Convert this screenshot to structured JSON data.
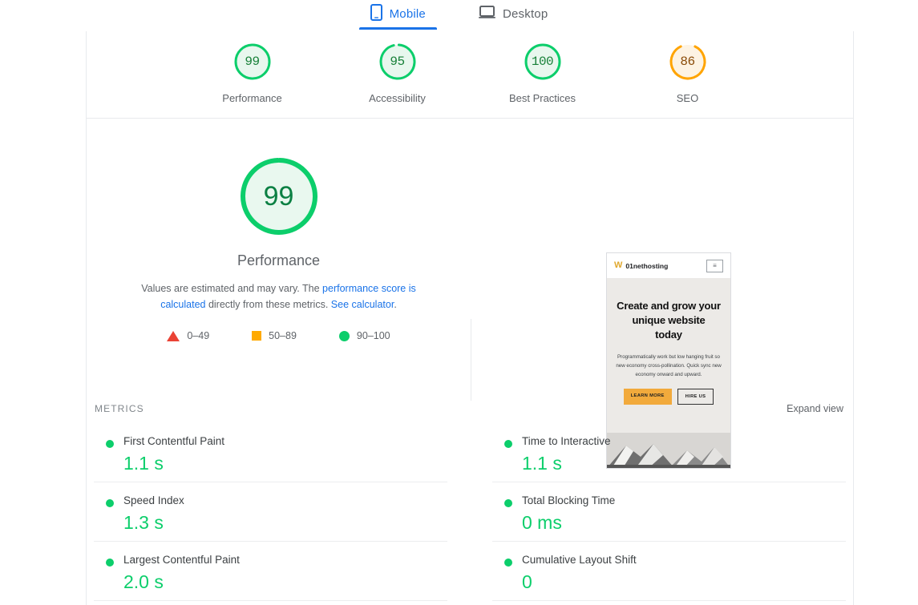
{
  "tabs": [
    {
      "label": "Mobile",
      "icon": "mobile-phone-icon",
      "active": true
    },
    {
      "label": "Desktop",
      "icon": "desktop-monitor-icon",
      "active": false
    }
  ],
  "category_scores": [
    {
      "label": "Performance",
      "score": "99",
      "value": 99,
      "color": "#0cce6b",
      "text_color": "#178038",
      "fill": "#e8f7ee"
    },
    {
      "label": "Accessibility",
      "score": "95",
      "value": 95,
      "color": "#0cce6b",
      "text_color": "#178038",
      "fill": "#e8f7ee"
    },
    {
      "label": "Best Practices",
      "score": "100",
      "value": 100,
      "color": "#0cce6b",
      "text_color": "#178038",
      "fill": "#e8f7ee"
    },
    {
      "label": "SEO",
      "score": "86",
      "value": 86,
      "color": "#ffa400",
      "text_color": "#8a4b08",
      "fill": "#fdf3e3"
    }
  ],
  "hero": {
    "score": "99",
    "score_value": 99,
    "title": "Performance",
    "desc_part1": "Values are estimated and may vary. The ",
    "desc_link1": "performance score is calculated",
    "desc_part2": " directly from these metrics. ",
    "desc_link2": "See calculator",
    "desc_part3": ".",
    "legend": [
      {
        "shape": "triangle",
        "range": "0–49",
        "color": "#ea4335"
      },
      {
        "shape": "square",
        "range": "50–89",
        "color": "#ffaa00"
      },
      {
        "shape": "circle",
        "range": "90–100",
        "color": "#0cce6b"
      }
    ]
  },
  "thumbnail": {
    "brand": "01nethosting",
    "logo": "W",
    "menu_icon": "hamburger-menu-icon",
    "heading_line1": "Create and grow your",
    "heading_line2": "unique website",
    "heading_line3": "today",
    "paragraph": "Programmatically work but low hanging fruit so new economy cross-pollination. Quick sync new economy onward and upward.",
    "button_primary": "LEARN MORE",
    "button_secondary": "HIRE US"
  },
  "metrics_section": {
    "title": "METRICS",
    "expand_label": "Expand view",
    "items": [
      {
        "label": "First Contentful Paint",
        "value": "1.1 s",
        "status": "pass",
        "color": "#0cce6b"
      },
      {
        "label": "Time to Interactive",
        "value": "1.1 s",
        "status": "pass",
        "color": "#0cce6b"
      },
      {
        "label": "Speed Index",
        "value": "1.3 s",
        "status": "pass",
        "color": "#0cce6b"
      },
      {
        "label": "Total Blocking Time",
        "value": "0 ms",
        "status": "pass",
        "color": "#0cce6b"
      },
      {
        "label": "Largest Contentful Paint",
        "value": "2.0 s",
        "status": "pass",
        "color": "#0cce6b"
      },
      {
        "label": "Cumulative Layout Shift",
        "value": "0",
        "status": "pass",
        "color": "#0cce6b"
      }
    ]
  }
}
